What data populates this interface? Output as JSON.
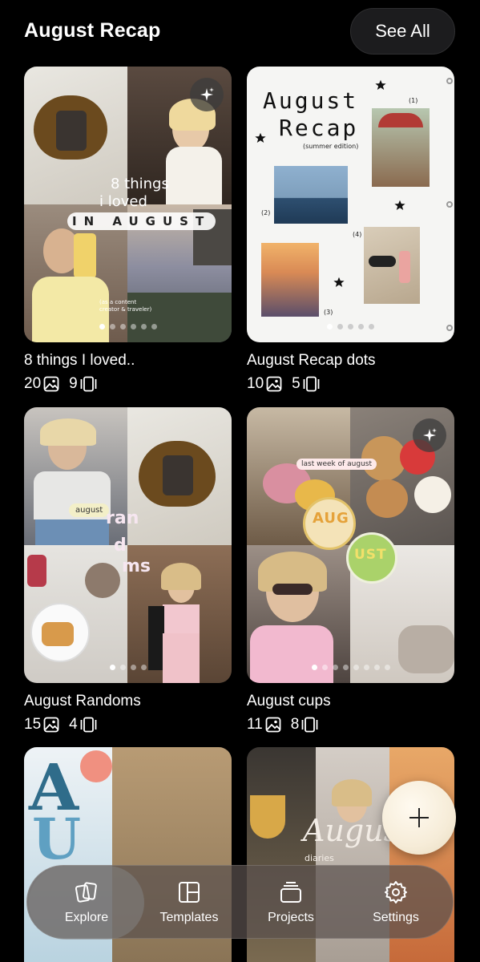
{
  "header": {
    "title": "August Recap",
    "see_all_label": "See All"
  },
  "cards": [
    {
      "title": "8 things I loved..",
      "images": "20",
      "slides": "9"
    },
    {
      "title": "August Recap dots",
      "images": "10",
      "slides": "5"
    },
    {
      "title": "August Randoms",
      "images": "15",
      "slides": "4"
    },
    {
      "title": "August cups",
      "images": "11",
      "slides": "8"
    }
  ],
  "overlays": {
    "card1_line1": "8 things",
    "card1_line2": "i loved",
    "card1_beads": "IN AUGUST",
    "card1_caption": "(as a content creator & traveler)",
    "card2_title1": "August",
    "card2_title2": "Recap",
    "card2_subtitle": "(summer edition)",
    "card2_n1": "(1)",
    "card2_n2": "(2)",
    "card2_n3": "(3)",
    "card2_n4": "(4)",
    "card3_sticker": "august",
    "card3_word1": "ran",
    "card3_word2": "d",
    "card3_word3": "ms",
    "card4_sticker": "last week of august",
    "card4_cup1": "AUG",
    "card4_cup2": "UST",
    "card6_script": "August",
    "card6_sub": "diaries"
  },
  "nav": {
    "items": [
      {
        "label": "Explore",
        "icon": "explore-icon"
      },
      {
        "label": "Templates",
        "icon": "templates-icon"
      },
      {
        "label": "Projects",
        "icon": "projects-icon"
      },
      {
        "label": "Settings",
        "icon": "settings-icon"
      }
    ],
    "active": "Explore"
  },
  "colors": {
    "background": "#000000",
    "text": "#ffffff",
    "nav_bg": "#5a504e",
    "fab": "#f6ecd8"
  }
}
